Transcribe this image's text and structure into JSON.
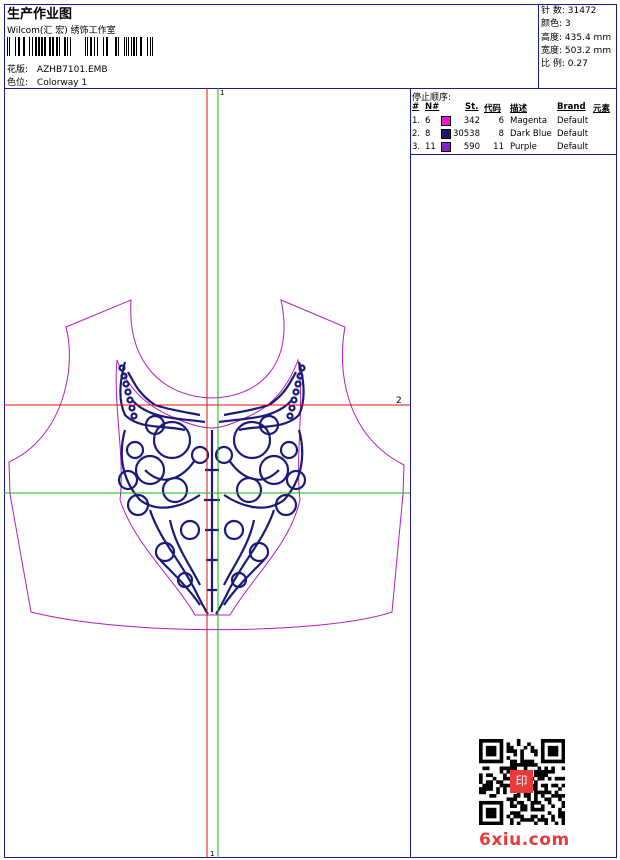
{
  "header": {
    "title": "生产作业图",
    "company": "Wilcom(汇 宏) 绣饰工作室",
    "design_label": "花版:",
    "design_value": "AZHB7101.EMB",
    "colorway_label": "色位:",
    "colorway_value": "Colorway 1"
  },
  "stats": [
    {
      "label": "针 数:",
      "value": "31472"
    },
    {
      "label": "颜色:",
      "value": "3"
    },
    {
      "label": "高度:",
      "value": "435.4 mm"
    },
    {
      "label": "宽度:",
      "value": "503.2 mm"
    },
    {
      "label": "比 例:",
      "value": "0.27"
    }
  ],
  "stop_sequence": {
    "title": "停止顺序:",
    "headers": {
      "index": "#",
      "no": "N#",
      "stitches": "St.",
      "code": "代码",
      "description": "描述",
      "brand": "Brand",
      "element": "元素"
    },
    "rows": [
      {
        "index": "1.",
        "no": "6",
        "color": "#e816d8",
        "stitches": "342",
        "code": "6",
        "description": "Magenta",
        "brand": "Default"
      },
      {
        "index": "2.",
        "no": "8",
        "color": "#1a1a6e",
        "stitches": "30538",
        "code": "8",
        "description": "Dark Blue",
        "brand": "Default"
      },
      {
        "index": "3.",
        "no": "11",
        "color": "#8a1ec8",
        "stitches": "590",
        "code": "11",
        "description": "Purple",
        "brand": "Default"
      }
    ]
  },
  "guides": {
    "top_marker": "1",
    "right_marker": "2",
    "bottom_marker": "1"
  },
  "colors": {
    "outline": "#b31cc0",
    "embroidery": "#1a1a78",
    "guide_red": "#e01010",
    "guide_green": "#10b810",
    "frame": "#1a1a8c"
  },
  "watermark": {
    "text": "6xiu.com",
    "stamp_text": "印"
  }
}
